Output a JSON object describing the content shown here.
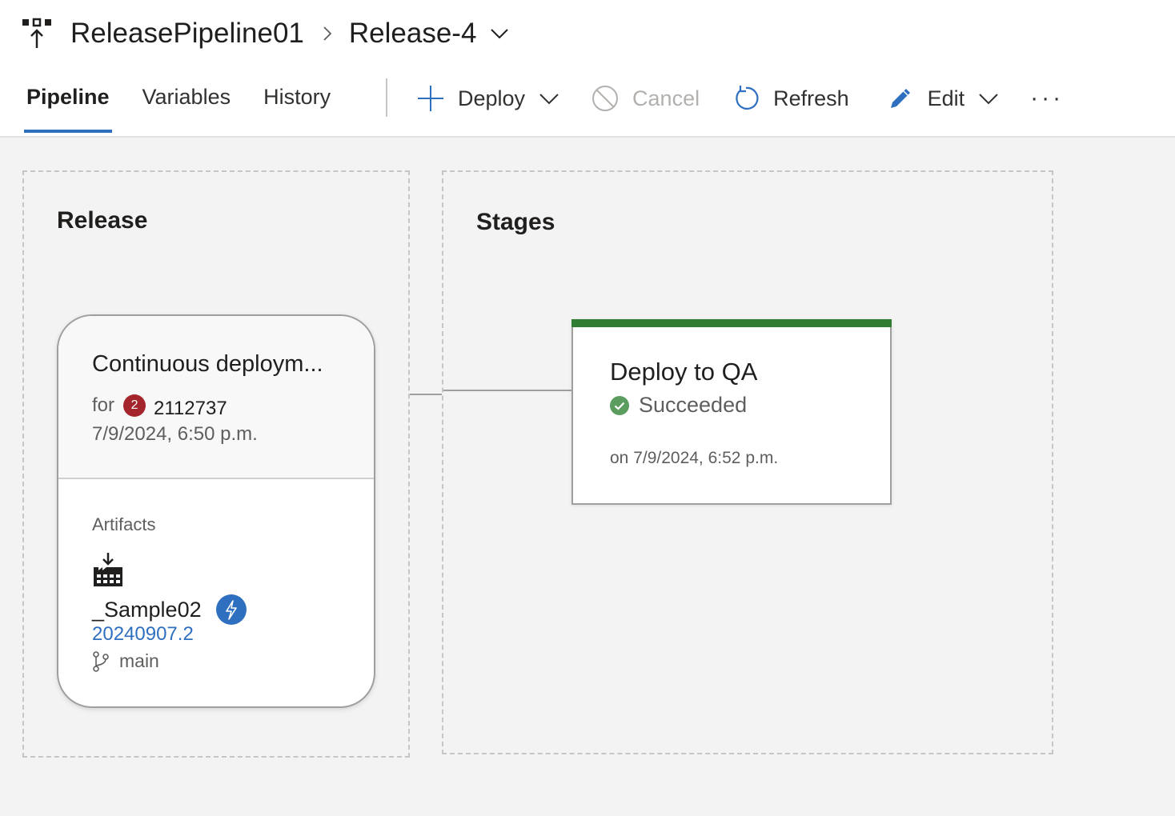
{
  "breadcrumb": {
    "pipeline": "ReleasePipeline01",
    "release": "Release-4"
  },
  "tabs": [
    {
      "label": "Pipeline",
      "active": true
    },
    {
      "label": "Variables",
      "active": false
    },
    {
      "label": "History",
      "active": false
    }
  ],
  "toolbar": {
    "deploy": "Deploy",
    "cancel": "Cancel",
    "refresh": "Refresh",
    "edit": "Edit",
    "more": "···"
  },
  "sections": {
    "release": "Release",
    "stages": "Stages"
  },
  "release_card": {
    "title": "Continuous deploym...",
    "for_label": "for",
    "badge_count": "2",
    "trigger_id": "2112737",
    "date": "7/9/2024, 6:50 p.m.",
    "artifacts_label": "Artifacts",
    "artifact": {
      "name": "_Sample02",
      "version": "20240907.2",
      "branch": "main"
    }
  },
  "stage": {
    "name": "Deploy to QA",
    "status": "Succeeded",
    "date": "on 7/9/2024, 6:52 p.m."
  },
  "colors": {
    "accent": "#2f6fbf",
    "success": "#2e7d32",
    "badge": "#a4262c"
  }
}
